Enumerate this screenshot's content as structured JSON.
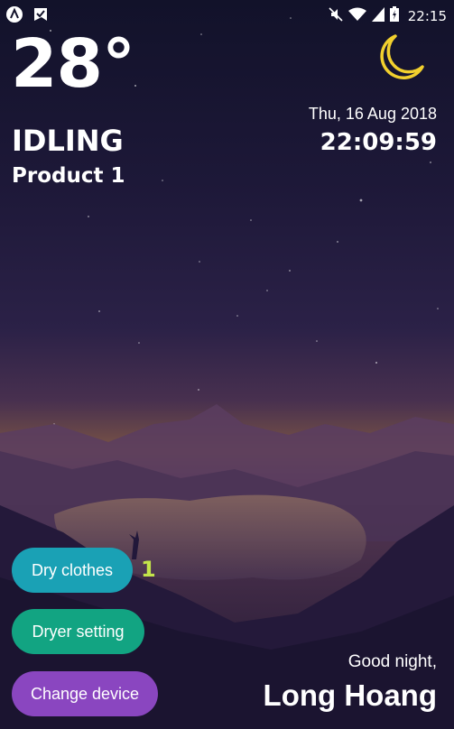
{
  "statusbar": {
    "left_icons": [
      "app-a-icon",
      "check-flag-icon"
    ],
    "right_icons": [
      "mute-icon",
      "wifi-icon",
      "signal-icon",
      "battery-icon"
    ],
    "time": "22:15"
  },
  "weather": {
    "temperature": "28°",
    "icon": "crescent-moon-icon"
  },
  "device": {
    "state": "IDLING",
    "product": "Product 1"
  },
  "datetime": {
    "date": "Thu, 16 Aug 2018",
    "time": "22:09:59"
  },
  "actions": {
    "dry_label": "Dry clothes",
    "dry_count": "1",
    "setting_label": "Dryer setting",
    "device_label": "Change device"
  },
  "greeting": {
    "text": "Good night,",
    "user": "Long Hoang"
  },
  "colors": {
    "dry": "#1aa1b5",
    "setting": "#12a482",
    "device": "#8a46c0",
    "count": "#c3e44a",
    "moon": "#f2d02e"
  }
}
